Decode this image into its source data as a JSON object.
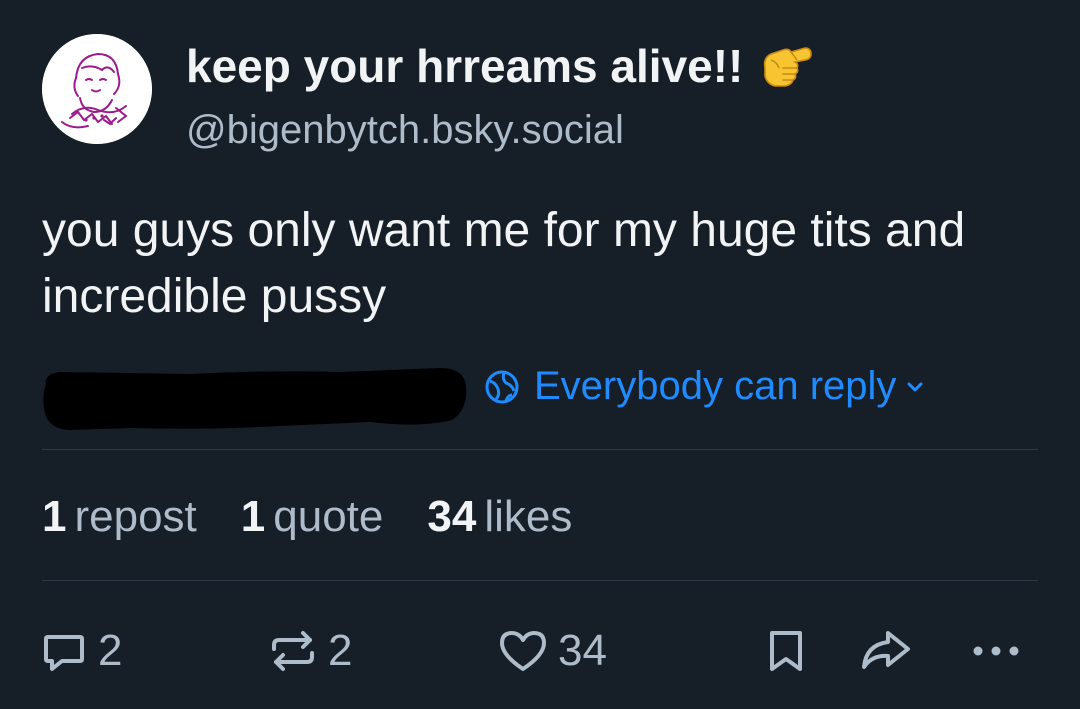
{
  "author": {
    "display_name": "keep your hrreams alive!!",
    "handle": "@bigenbytch.bsky.social",
    "emoji": "pointing-hand-emoji"
  },
  "post": {
    "text": "you guys only want me for my huge tits and incredible pussy"
  },
  "reply_setting": {
    "label": "Everybody can reply",
    "icon": "globe-icon"
  },
  "stats": {
    "reposts": {
      "count": "1",
      "label": "repost"
    },
    "quotes": {
      "count": "1",
      "label": "quote"
    },
    "likes": {
      "count": "34",
      "label": "likes"
    }
  },
  "actions": {
    "reply_count": "2",
    "repost_count": "2",
    "like_count": "34"
  },
  "colors": {
    "background": "#161e27",
    "text": "#f1f3f5",
    "muted": "#aebbc9",
    "accent": "#208bfe",
    "divider": "#2e3a48"
  }
}
